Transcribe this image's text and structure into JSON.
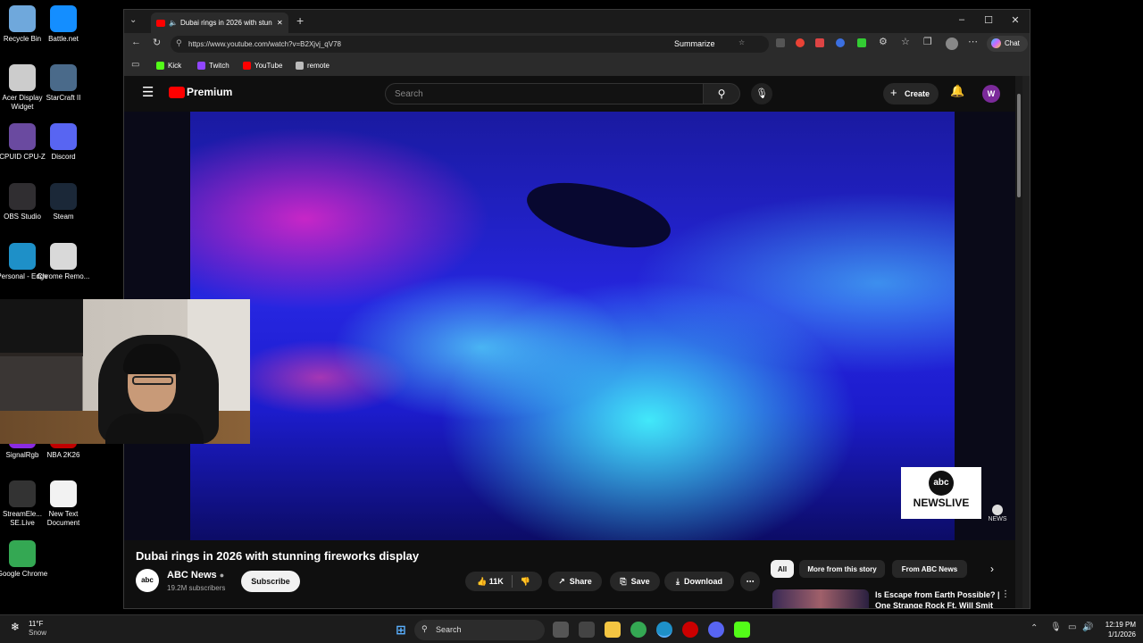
{
  "desktop": {
    "icons": [
      {
        "label": "Recycle Bin",
        "icon": "recycle-bin-icon",
        "color": "#6fa8dc"
      },
      {
        "label": "Battle.net",
        "icon": "battlenet-icon",
        "color": "#148eff"
      },
      {
        "label": "Acer Display Widget",
        "icon": "acer-icon",
        "color": "#cccccc"
      },
      {
        "label": "StarCraft II",
        "icon": "starcraft-icon",
        "color": "#4a6a8a"
      },
      {
        "label": "CPUID CPU-Z",
        "icon": "cpuz-icon",
        "color": "#6a4aa0"
      },
      {
        "label": "Discord",
        "icon": "discord-icon",
        "color": "#5865f2"
      },
      {
        "label": "OBS Studio",
        "icon": "obs-icon",
        "color": "#302e31"
      },
      {
        "label": "Steam",
        "icon": "steam-icon",
        "color": "#1b2838"
      },
      {
        "label": "Personal - Edge",
        "icon": "edge-icon",
        "color": "#1e90c8"
      },
      {
        "label": "Chrome Remo...",
        "icon": "chrome-remote-icon",
        "color": "#d9d9d9"
      },
      {
        "label": "SignalRgb",
        "icon": "signalrgb-icon",
        "color": "#8a2be2"
      },
      {
        "label": "NBA 2K26",
        "icon": "nba-icon",
        "color": "#c00000"
      },
      {
        "label": "StreamEle... SE.Live",
        "icon": "streamelements-icon",
        "color": "#333333"
      },
      {
        "label": "New Text Document",
        "icon": "text-document-icon",
        "color": "#f2f2f2"
      },
      {
        "label": "Google Chrome",
        "icon": "chrome-icon",
        "color": "#34a853"
      }
    ]
  },
  "browser": {
    "tab_title": "Dubai rings in 2026 with stun",
    "url": "https://www.youtube.com/watch?v=B2Xjvj_qV78",
    "summarize_label": "Summarize",
    "chat_label": "Chat",
    "bookmarks": [
      {
        "label": "Kick",
        "color": "#53fc18"
      },
      {
        "label": "Twitch",
        "color": "#9146ff"
      },
      {
        "label": "YouTube",
        "color": "#ff0000"
      },
      {
        "label": "remote",
        "color": "#bbbbbb"
      }
    ]
  },
  "youtube": {
    "logo_label": "Premium",
    "search_placeholder": "Search",
    "create_label": "Create",
    "avatar_letter": "W",
    "video_title": "Dubai rings in 2026 with stunning fireworks display",
    "channel_name": "ABC News",
    "subscribers": "19.2M subscribers",
    "subscribe_label": "Subscribe",
    "likes": "11K",
    "share_label": "Share",
    "save_label": "Save",
    "download_label": "Download",
    "chips": [
      "All",
      "More from this story",
      "From ABC News"
    ],
    "badge_line1": "abc",
    "badge_line2": "NEWSLIVE",
    "watermark": "NEWS",
    "recommendation_title": "Is Escape from Earth Possible? | One Strange Rock Ft. Will Smit",
    "accent": "#ff0000"
  },
  "taskbar": {
    "temperature": "11°F",
    "weather_label": "Snow",
    "search_label": "Search",
    "time": "12:19 PM",
    "date": "1/1/2026"
  }
}
